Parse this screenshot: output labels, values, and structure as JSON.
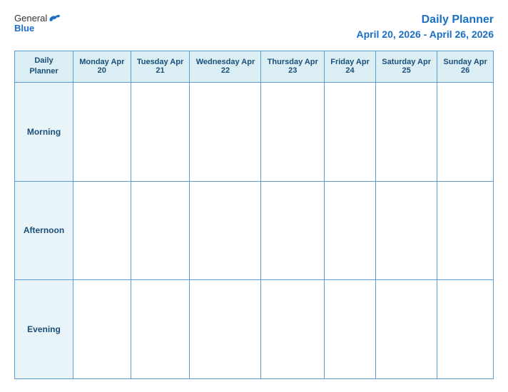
{
  "logo": {
    "general": "General",
    "blue": "Blue"
  },
  "header": {
    "title": "Daily Planner",
    "date_range": "April 20, 2026 - April 26, 2026"
  },
  "table": {
    "label_col": {
      "line1": "Daily",
      "line2": "Planner"
    },
    "days": [
      {
        "name": "Monday",
        "date": "Apr 20"
      },
      {
        "name": "Tuesday",
        "date": "Apr 21"
      },
      {
        "name": "Wednesday",
        "date": "Apr 22"
      },
      {
        "name": "Thursday",
        "date": "Apr 23"
      },
      {
        "name": "Friday",
        "date": "Apr 24"
      },
      {
        "name": "Saturday",
        "date": "Apr 25"
      },
      {
        "name": "Sunday",
        "date": "Apr 26"
      }
    ],
    "rows": [
      {
        "label": "Morning"
      },
      {
        "label": "Afternoon"
      },
      {
        "label": "Evening"
      }
    ]
  }
}
